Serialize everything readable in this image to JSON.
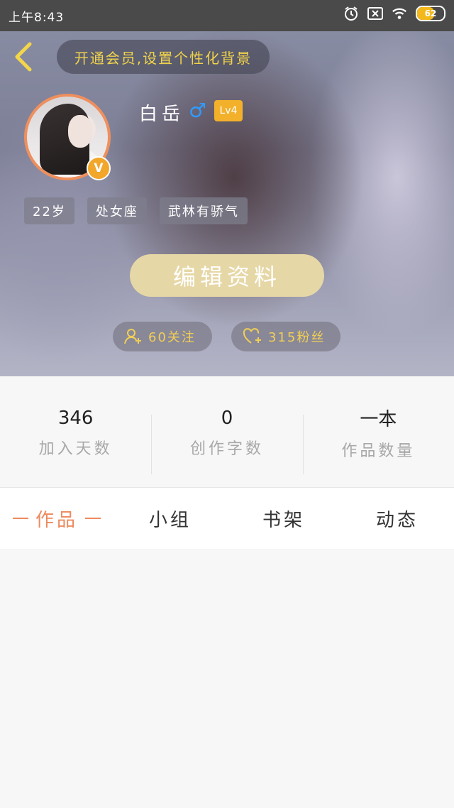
{
  "status_bar": {
    "time": "上午8:43",
    "battery": "62"
  },
  "header": {
    "vip_banner": "开通会员,设置个性化背景"
  },
  "profile": {
    "name": "白岳",
    "gender_symbol": "♂",
    "level": "Lv4",
    "vip_badge": "V",
    "tags": [
      "22岁",
      "处女座",
      "武林有骄气"
    ],
    "edit_label": "编辑资料",
    "follow_label": "60关注",
    "fans_label": "315粉丝"
  },
  "stats": [
    {
      "value": "346",
      "label": "加入天数"
    },
    {
      "value": "0",
      "label": "创作字数"
    },
    {
      "value": "一本",
      "label": "作品数量"
    }
  ],
  "tabs": [
    {
      "label": "作品",
      "active": true
    },
    {
      "label": "小组",
      "active": false
    },
    {
      "label": "书架",
      "active": false
    },
    {
      "label": "动态",
      "active": false
    }
  ],
  "colors": {
    "accent": "#ee8a5e",
    "gold": "#f1cf55",
    "level_badge": "#f2b02b",
    "edit_button": "#e6d7a6",
    "gender": "#2f9bff"
  }
}
